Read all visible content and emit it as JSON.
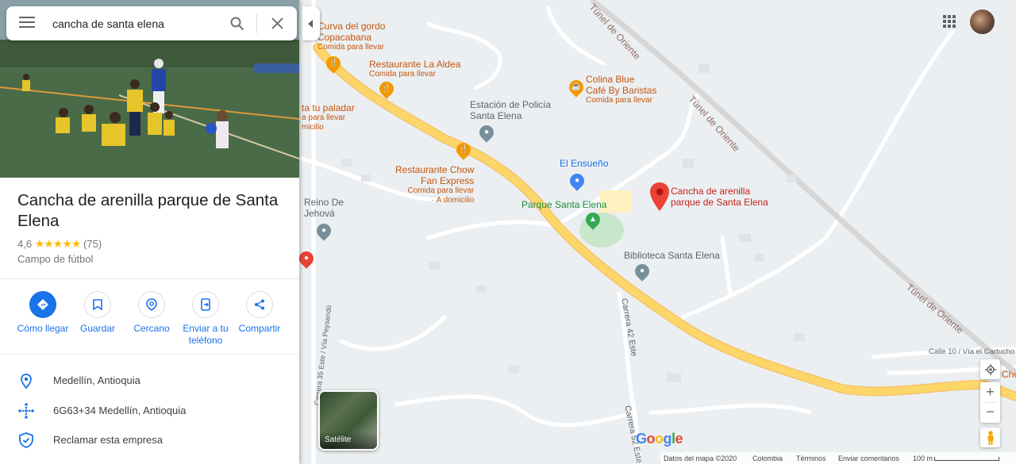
{
  "search": {
    "value": "cancha de santa elena"
  },
  "place": {
    "title": "Cancha de arenilla parque de Santa Elena",
    "rating": "4,6",
    "stars": "★★★★★",
    "reviews": "(75)",
    "category": "Campo de fútbol"
  },
  "actions": [
    {
      "label": "Cómo llegar"
    },
    {
      "label": "Guardar"
    },
    {
      "label": "Cercano"
    },
    {
      "label": "Enviar a tu teléfono"
    },
    {
      "label": "Compartir"
    }
  ],
  "info": [
    {
      "text": "Medellín, Antioquia",
      "icon": "location-pin-icon"
    },
    {
      "text": "6G63+34 Medellín, Antioquia",
      "icon": "plus-code-icon"
    },
    {
      "text": "Reclamar esta empresa",
      "icon": "verified-shield-icon"
    }
  ],
  "map": {
    "labels": {
      "curva_line1": "Curva del gordo",
      "curva_line2": "Copacabana",
      "curva_sub": "Comida para llevar",
      "aldea": "Restaurante La Aldea",
      "aldea_sub": "Comida para llevar",
      "colina_line1": "Colina Blue",
      "colina_line2": "Café By Baristas",
      "colina_sub": "Comida para llevar",
      "paladar": "ta tu paladar",
      "paladar_sub1": "a para llevar",
      "paladar_sub2": "micilio",
      "policia_line1": "Estación de Policía",
      "policia_line2": "Santa Elena",
      "chow_line1": "Restaurante Chow",
      "chow_line2": "Fan Express",
      "chow_sub1": "Comida para llevar",
      "chow_sub2": "· A domicilio",
      "ensueno": "El Ensueño",
      "cancha_line1": "Cancha de arenilla",
      "cancha_line2": "parque de Santa Elena",
      "parque": "Parque Santa Elena",
      "reino_line1": "Reino De",
      "reino_line2": "Jehová",
      "biblioteca": "Biblioteca Santa Elena",
      "carrera42": "Carrera 42 Este",
      "carrera35": "Carrera 35 Este / Vía Peysandú",
      "carrera52": "Carrera 52 Este",
      "tunel1": "Túnel de Oriente",
      "tunel2": "Túnel de Oriente",
      "tunel3": "Túnel de Oriente",
      "calle10": "Calle 10 / Vía el Cartucho",
      "che": "Che"
    },
    "satellite_label": "Satélite",
    "google_logo": "Google",
    "footer": {
      "data": "Datos del mapa ©2020",
      "country": "Colombia",
      "terms": "Términos",
      "feedback": "Enviar comentarios",
      "scale": "100 m"
    },
    "colors": {
      "road_major": "#fdd66a",
      "road_minor": "#ffffff",
      "park": "#c8e6c9",
      "pin_red": "#ea4335",
      "food": "#f29900"
    }
  }
}
